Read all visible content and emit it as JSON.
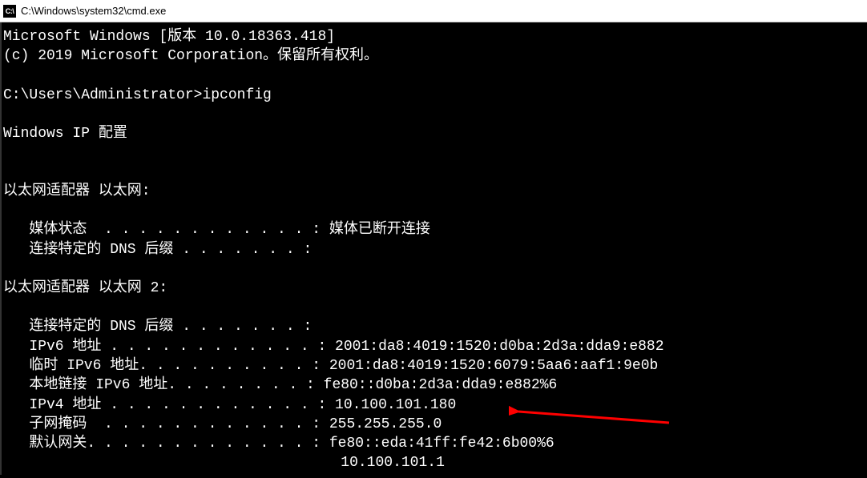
{
  "window": {
    "title": "C:\\Windows\\system32\\cmd.exe",
    "icon_label": "C:\\"
  },
  "terminal": {
    "lines": [
      "Microsoft Windows [版本 10.0.18363.418]",
      "(c) 2019 Microsoft Corporation。保留所有权利。",
      "",
      "C:\\Users\\Administrator>ipconfig",
      "",
      "Windows IP 配置",
      "",
      "",
      "以太网适配器 以太网:",
      "",
      "   媒体状态  . . . . . . . . . . . . : 媒体已断开连接",
      "   连接特定的 DNS 后缀 . . . . . . . :",
      "",
      "以太网适配器 以太网 2:",
      "",
      "   连接特定的 DNS 后缀 . . . . . . . :",
      "   IPv6 地址 . . . . . . . . . . . . : 2001:da8:4019:1520:d0ba:2d3a:dda9:e882",
      "   临时 IPv6 地址. . . . . . . . . . : 2001:da8:4019:1520:6079:5aa6:aaf1:9e0b",
      "   本地链接 IPv6 地址. . . . . . . . : fe80::d0ba:2d3a:dda9:e882%6",
      "   IPv4 地址 . . . . . . . . . . . . : 10.100.101.180",
      "   子网掩码  . . . . . . . . . . . . : 255.255.255.0",
      "   默认网关. . . . . . . . . . . . . : fe80::eda:41ff:fe42:6b00%6",
      "                                       10.100.101.1"
    ]
  },
  "annotation": {
    "arrow_color": "#ff0000"
  }
}
